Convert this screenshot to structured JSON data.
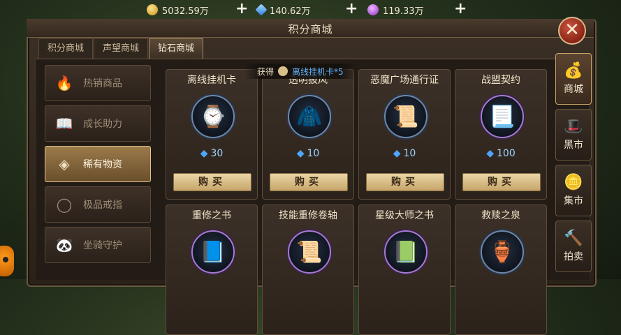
{
  "currencies": [
    {
      "icon": "gold-coin-icon",
      "value": "5032.59万",
      "color": "#e2b33a"
    },
    {
      "icon": "blue-diamond-icon",
      "value": "140.62万",
      "color": "#4fa6ff"
    },
    {
      "icon": "purple-gem-icon",
      "value": "119.33万",
      "color": "#b35ce8"
    }
  ],
  "plus_label": "+",
  "window": {
    "title": "积分商城",
    "close_label": "✕"
  },
  "tabs": [
    {
      "label": "积分商城",
      "active": false
    },
    {
      "label": "声望商城",
      "active": false
    },
    {
      "label": "钻石商城",
      "active": true
    }
  ],
  "categories": [
    {
      "label": "热销商品",
      "icon": "flame-icon",
      "glyph": "🔥",
      "active": false
    },
    {
      "label": "成长助力",
      "icon": "book-icon",
      "glyph": "📖",
      "active": false
    },
    {
      "label": "稀有物资",
      "icon": "crystal-icon",
      "glyph": "◈",
      "active": true
    },
    {
      "label": "极品戒指",
      "icon": "ring-icon",
      "glyph": "◯",
      "active": false
    },
    {
      "label": "坐骑守护",
      "icon": "mount-icon",
      "glyph": "🐼",
      "active": false
    }
  ],
  "tooltip": {
    "prefix": "获得",
    "item": "离线挂机卡*5"
  },
  "items": [
    {
      "name": "离线挂机卡",
      "icon": "pocket-watch-icon",
      "glyph": "⌚",
      "price": "30",
      "buy": "购买"
    },
    {
      "name": "透明披风",
      "icon": "cloak-icon",
      "glyph": "🧥",
      "price": "10",
      "buy": "购买"
    },
    {
      "name": "恶魔广场通行证",
      "icon": "scroll-icon",
      "glyph": "📜",
      "price": "10",
      "buy": "购买"
    },
    {
      "name": "战盟契约",
      "icon": "contract-icon",
      "glyph": "📃",
      "price": "100",
      "buy": "购买"
    },
    {
      "name": "重修之书",
      "icon": "spellbook-icon",
      "glyph": "📘",
      "price": "",
      "buy": ""
    },
    {
      "name": "技能重修卷轴",
      "icon": "skill-scroll-icon",
      "glyph": "📜",
      "price": "",
      "buy": ""
    },
    {
      "name": "星级大师之书",
      "icon": "star-book-icon",
      "glyph": "📗",
      "price": "",
      "buy": ""
    },
    {
      "name": "救赎之泉",
      "icon": "fountain-bowl-icon",
      "glyph": "🏺",
      "price": "",
      "buy": ""
    }
  ],
  "side_nav": [
    {
      "label": "商城",
      "icon": "money-bag-icon",
      "glyph": "💰",
      "active": true
    },
    {
      "label": "黑市",
      "icon": "merchant-icon",
      "glyph": "🎩",
      "active": false
    },
    {
      "label": "集市",
      "icon": "coin-stack-icon",
      "glyph": "🪙",
      "active": false
    },
    {
      "label": "拍卖",
      "icon": "gavel-icon",
      "glyph": "🔨",
      "active": false
    }
  ]
}
